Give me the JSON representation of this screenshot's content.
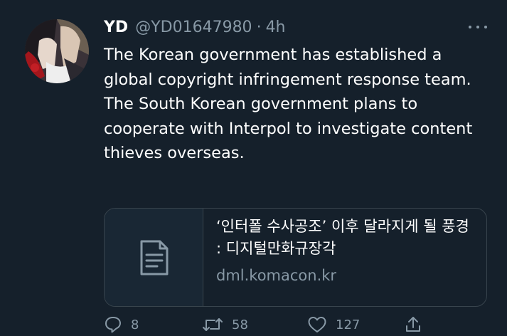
{
  "tweet": {
    "display_name": "YD",
    "handle": "@YD01647980",
    "separator": "·",
    "time": "4h",
    "text_lines": [
      "The Korean government has established a global copyright infringement response team.",
      "The South Korean government plans to cooperate with Interpol to investigate content thieves overseas."
    ]
  },
  "card": {
    "title": "‘인터폴 수사공조’ 이후 달라지게 될 풍경 : 디지털만화규장각",
    "domain": "dml.komacon.kr",
    "thumb_icon": "document-icon"
  },
  "actions": {
    "reply_count": "8",
    "retweet_count": "58",
    "like_count": "127"
  },
  "colors": {
    "background": "#15202b",
    "text": "#ffffff",
    "muted": "#8899a6",
    "border": "#38444d"
  }
}
